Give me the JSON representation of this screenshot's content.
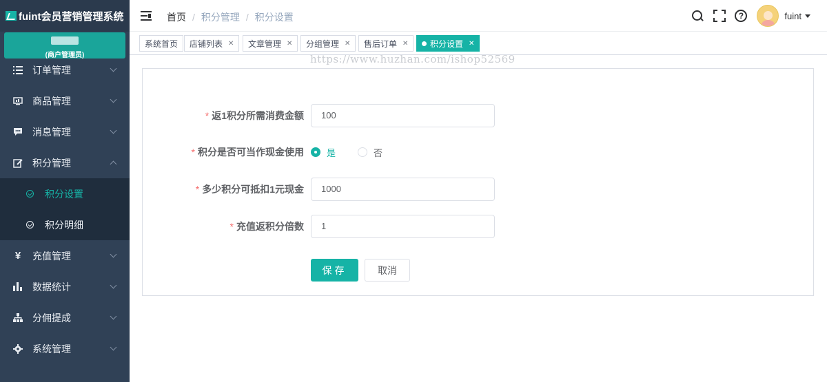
{
  "app": {
    "title": "fuint会员营销管理系统",
    "user_role": "(商户管理员)"
  },
  "sidebar": {
    "items": [
      {
        "label": "订单管理",
        "icon": "list-icon"
      },
      {
        "label": "商品管理",
        "icon": "monitor-icon"
      },
      {
        "label": "消息管理",
        "icon": "message-icon"
      },
      {
        "label": "积分管理",
        "icon": "edit-icon",
        "expanded": true
      },
      {
        "label": "充值管理",
        "icon": "yen-icon"
      },
      {
        "label": "数据统计",
        "icon": "bar-chart-icon"
      },
      {
        "label": "分佣提成",
        "icon": "tree-icon"
      },
      {
        "label": "系统管理",
        "icon": "gear-icon"
      }
    ],
    "submenu": [
      {
        "label": "积分设置",
        "active": true
      },
      {
        "label": "积分明细",
        "active": false
      }
    ]
  },
  "navbar": {
    "breadcrumb": [
      "首页",
      "积分管理",
      "积分设置"
    ],
    "username": "fuint"
  },
  "tags": [
    {
      "label": "系统首页",
      "closable": false
    },
    {
      "label": "店铺列表",
      "closable": true
    },
    {
      "label": "文章管理",
      "closable": true
    },
    {
      "label": "分组管理",
      "closable": true
    },
    {
      "label": "售后订单",
      "closable": true
    },
    {
      "label": "积分设置",
      "closable": true,
      "active": true
    }
  ],
  "watermark": "https://www.huzhan.com/ishop52569",
  "form": {
    "field1": {
      "label": "返1积分所需消费金额",
      "value": "100"
    },
    "field2": {
      "label": "积分是否可当作现金使用",
      "options": [
        "是",
        "否"
      ],
      "selected": "是"
    },
    "field3": {
      "label": "多少积分可抵扣1元现金",
      "value": "1000"
    },
    "field4": {
      "label": "充值返积分倍数",
      "value": "1"
    },
    "save_label": "保存",
    "cancel_label": "取消"
  },
  "colors": {
    "accent": "#16b3a6",
    "sidebar_bg": "#304156",
    "submenu_bg": "#1f2d3d",
    "required": "#f56c6c"
  }
}
